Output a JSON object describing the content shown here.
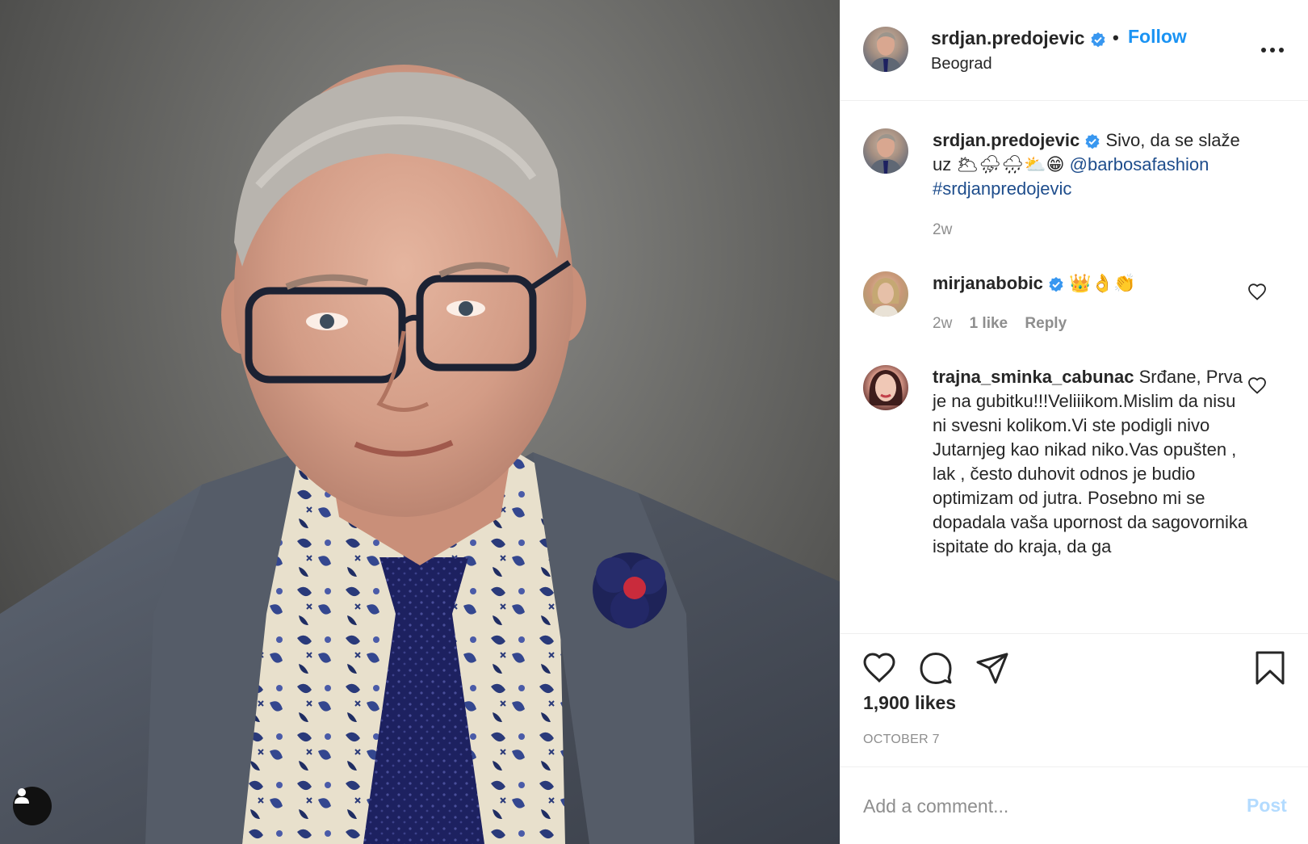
{
  "post": {
    "username": "srdjan.predojevic",
    "verified_icon": "verified-badge-icon",
    "separator": "•",
    "follow_label": "Follow",
    "location": "Beograd",
    "more_icon": "more-options-icon"
  },
  "caption": {
    "username": "srdjan.predojevic",
    "text_before": "Sivo, da se slaže uz",
    "emoji": "🌥⛈🌧⛅😁",
    "mention": "@barbosafashion",
    "hashtag": "#srdjanpredojevic",
    "time": "2w"
  },
  "comments": [
    {
      "username": "mirjanabobic",
      "verified": true,
      "text": "👑👌👏",
      "time": "2w",
      "likes": "1 like",
      "reply_label": "Reply"
    },
    {
      "username": "trajna_sminka_cabunac",
      "verified": false,
      "text": "Srđane, Prva je na gubitku!!!Veliiikom.Mislim da nisu ni svesni kolikom.Vi ste podigli nivo Jutarnjeg kao nikad niko.Vas opušten , lak , često duhovit odnos je budio optimizam od jutra. Posebno mi se dopadala vaša upornost da sagovornika ispitate do kraja, da ga"
    }
  ],
  "actions": {
    "like_icon": "heart-icon",
    "comment_icon": "comment-icon",
    "share_icon": "share-icon",
    "save_icon": "bookmark-icon",
    "likes_text": "1,900 likes",
    "date": "OCTOBER 7"
  },
  "composer": {
    "placeholder": "Add a comment...",
    "post_label": "Post"
  },
  "colors": {
    "link_blue": "#1a93f3",
    "mention_blue": "#1e4d8c",
    "verified_blue": "#3897f0",
    "muted": "#8e8e8e",
    "post_disabled": "#b3dbff"
  }
}
